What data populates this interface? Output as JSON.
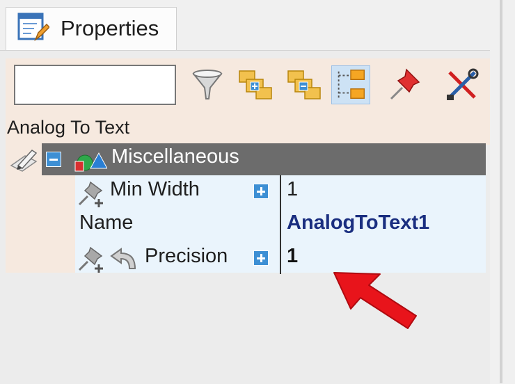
{
  "tab": {
    "label": "Properties",
    "icon": "properties-window-icon"
  },
  "toolbar": {
    "search": {
      "value": "",
      "placeholder": ""
    },
    "buttons": [
      {
        "name": "filter-button",
        "icon": "funnel-icon"
      },
      {
        "name": "categorized-button",
        "icon": "categorized-folders-icon"
      },
      {
        "name": "alphabetical-button",
        "icon": "alphabetical-folders-icon"
      },
      {
        "name": "properties-button",
        "icon": "property-pages-icon",
        "active": true
      },
      {
        "name": "pin-button",
        "icon": "pushpin-icon"
      },
      {
        "name": "tools-button",
        "icon": "tools-icon"
      }
    ]
  },
  "object": {
    "name": "Analog To Text"
  },
  "category": {
    "label": "Miscellaneous",
    "expanded": true
  },
  "properties": [
    {
      "name": "Min Width",
      "value": "1",
      "expandable": true,
      "value_style": "normal"
    },
    {
      "name": "Name",
      "value": "AnalogToText1",
      "expandable": false,
      "value_style": "bold-blue"
    },
    {
      "name": "Precision",
      "value": "1",
      "expandable": true,
      "value_style": "bold"
    }
  ],
  "colors": {
    "accent": "#3d8fd4",
    "category_bar": "#6c6c6c",
    "header_bg": "#f6e9df",
    "grid_bg": "#eaf4fc",
    "annotation_arrow": "#e8141b",
    "name_value": "#1a2e80"
  }
}
